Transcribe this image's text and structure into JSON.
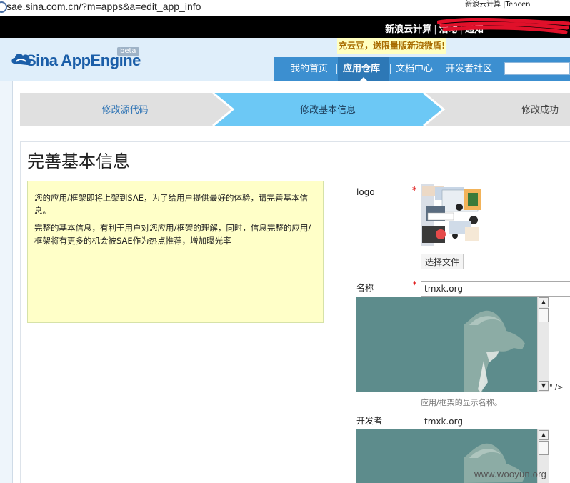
{
  "browser": {
    "url": "sae.sina.com.cn/?m=apps&a=edit_app_info"
  },
  "topbar": {
    "items": [
      "新浪云计算",
      "活动",
      "通知"
    ],
    "user_fragment": "新浪云计算 |Tencen"
  },
  "header": {
    "logo_main": "Sina",
    "logo_sub": "AppEngine",
    "beta": "beta",
    "promo": "充云豆，送限量版新浪微盾!"
  },
  "nav": {
    "items": [
      {
        "label": "我的首页"
      },
      {
        "label": "应用仓库"
      },
      {
        "label": "文档中心"
      },
      {
        "label": "开发者社区"
      }
    ],
    "active_index": 1
  },
  "steps": {
    "items": [
      {
        "label": "修改源代码"
      },
      {
        "label": "修改基本信息"
      },
      {
        "label": "修改成功"
      }
    ],
    "active_index": 1
  },
  "page": {
    "title": "完善基本信息",
    "notice_p1": "您的应用/框架即将上架到SAE，为了给用户提供最好的体验，请完善基本信息。",
    "notice_p2": "完整的基本信息，有利于用户对您应用/框架的理解，同时，信息完整的应用/框架将有更多的机会被SAE作为热点推荐，增加曝光率"
  },
  "form": {
    "logo_label": "logo",
    "required_mark": "*",
    "choose_file": "选择文件",
    "name_label": "名称",
    "name_value": "tmxk.org",
    "name_hint": "应用/框架的显示名称。",
    "stray_text": "\" />",
    "developer_label": "开发者",
    "developer_value": "tmxk.org"
  },
  "watermark": "www.wooyun.org",
  "colors": {
    "nav_bg": "#3c8fd0",
    "step_active": "#6cc8f5",
    "step_inactive": "#e0e0e0",
    "notice_bg": "#ffffc8",
    "injected_image_bg": "#5d8c8c"
  },
  "icons": {
    "scroll_up": "▲",
    "scroll_down": "▼"
  }
}
